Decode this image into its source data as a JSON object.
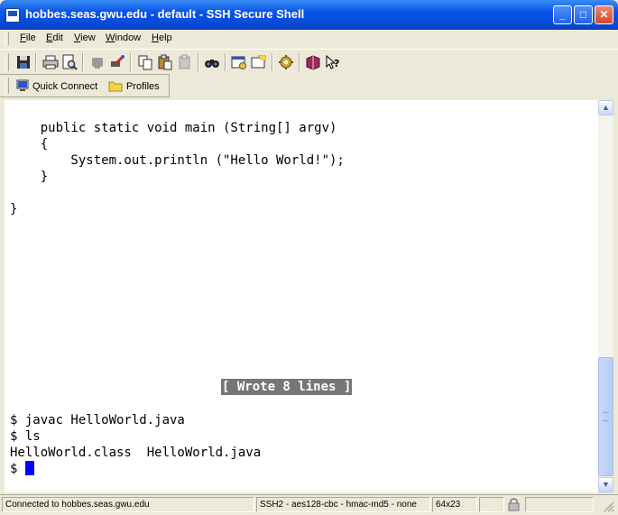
{
  "window": {
    "title": "hobbes.seas.gwu.edu - default - SSH Secure Shell",
    "app_icon": "ssh-shell-icon",
    "controls": [
      "minimize-icon",
      "maximize-icon",
      "close-icon"
    ]
  },
  "menu": {
    "items": [
      {
        "u": "F",
        "rest": "ile"
      },
      {
        "u": "E",
        "rest": "dit"
      },
      {
        "u": "V",
        "rest": "iew"
      },
      {
        "u": "W",
        "rest": "indow"
      },
      {
        "u": "H",
        "rest": "elp"
      }
    ]
  },
  "toolbar": {
    "icons": [
      "save-icon",
      "print-icon",
      "print-preview-icon",
      "disconnect-icon",
      "connect-icon",
      "copy-icon",
      "paste-icon",
      "paste-disabled-icon",
      "find-icon",
      "settings-icon",
      "new-file-transfer-icon",
      "key-icon",
      "book-icon",
      "help-context-icon"
    ]
  },
  "profilebar": {
    "quick_connect": "Quick Connect",
    "profiles": "Profiles"
  },
  "terminal": {
    "lines": [
      "    public static void main (String[] argv)",
      "    {",
      "        System.out.println (\"Hello World!\");",
      "    }",
      "",
      "}"
    ],
    "wrote_message": "[ Wrote 8 lines ]",
    "shell_lines": [
      "$ javac HelloWorld.java",
      "$ ls",
      "HelloWorld.class  HelloWorld.java"
    ],
    "prompt": "$ ",
    "cursor_color": "#0000FF"
  },
  "status": {
    "connection": "Connected to hobbes.seas.gwu.edu",
    "cipher": "SSH2 - aes128-cbc - hmac-md5 - none",
    "size": "64x23"
  },
  "colors": {
    "titlebar": "#0A54E6",
    "chrome": "#ECE9D8",
    "terminal_bg": "#FFFFFF"
  }
}
